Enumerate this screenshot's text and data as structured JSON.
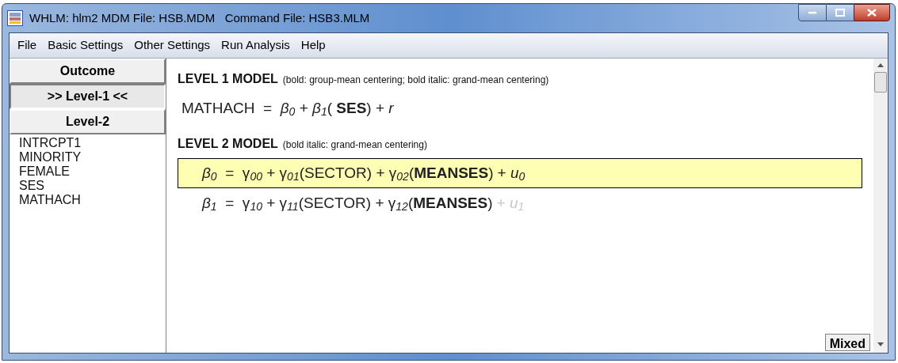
{
  "window": {
    "title": "WHLM: hlm2 MDM File: HSB.MDM   Command File: HSB3.MLM"
  },
  "menu": [
    "File",
    "Basic Settings",
    "Other Settings",
    "Run Analysis",
    "Help"
  ],
  "sidebar": {
    "buttons": [
      {
        "label": "Outcome",
        "selected": false
      },
      {
        "label": ">> Level-1 <<",
        "selected": true
      },
      {
        "label": "Level-2",
        "selected": false
      }
    ],
    "variables": [
      "INTRCPT1",
      "MINORITY",
      "FEMALE",
      "SES",
      "MATHACH"
    ]
  },
  "models": [
    {
      "title": "LEVEL 1 MODEL",
      "note": "(bold: group-mean centering; bold italic: grand-mean centering)",
      "equations": [
        {
          "text": "MATHACH  =  *β*$_{0}$ + *β*$_{1}$( **SES**) + *r*",
          "selected": false
        }
      ]
    },
    {
      "title": "LEVEL 2 MODEL",
      "note": "(bold italic: grand-mean centering)",
      "equations": [
        {
          "text": "*β*$_{0}$  =  γ$_{00}$ + γ$_{01}$(SECTOR) + γ$_{02}$(**MEANSES**)",
          "error_term": "+ *u*$_{0}$",
          "error_enabled": true,
          "selected": true
        },
        {
          "text": "*β*$_{1}$  =  γ$_{10}$ + γ$_{11}$(SECTOR) + γ$_{12}$(**MEANSES**)",
          "error_term": "+ *u*$_{1}$",
          "error_enabled": false,
          "selected": false
        }
      ]
    }
  ],
  "mixed_button": "Mixed"
}
